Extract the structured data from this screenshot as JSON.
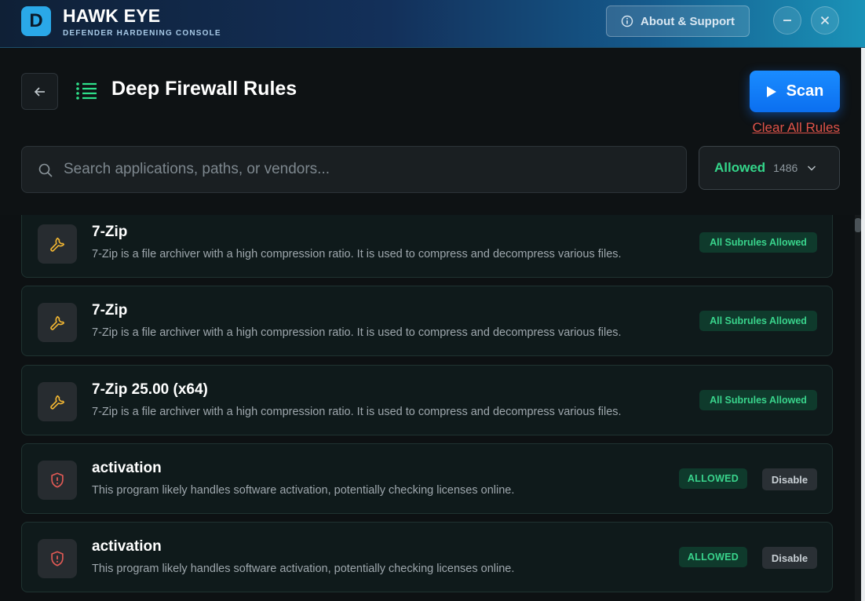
{
  "app": {
    "name": "HAWK EYE",
    "subtitle": "DEFENDER HARDENING CONSOLE",
    "logo_letter": "D"
  },
  "titlebar": {
    "about_label": "About & Support",
    "about_icon": "info-icon",
    "minimize_icon": "minus-icon",
    "close_icon": "close-icon"
  },
  "header": {
    "back_icon": "arrow-left-icon",
    "title_icon": "list-icon",
    "title": "Deep Firewall Rules",
    "scan_label": "Scan",
    "scan_icon": "play-icon",
    "clear_label": "Clear All Rules"
  },
  "search": {
    "placeholder": "Search applications, paths, or vendors...",
    "value": ""
  },
  "filter": {
    "selected": "Allowed",
    "count": "1486"
  },
  "colors": {
    "accent_blue": "#0b6ff0",
    "allowed_green": "#34d58a",
    "danger_red": "#e0534a",
    "wrench_yellow": "#f2b632"
  },
  "rules": [
    {
      "name": "7-Zip",
      "description": "7-Zip is a file archiver with a high compression ratio. It is used to compress and decompress various files.",
      "icon": "wrench-icon",
      "badge": "All Subrules Allowed"
    },
    {
      "name": "7-Zip",
      "description": "7-Zip is a file archiver with a high compression ratio. It is used to compress and decompress various files.",
      "icon": "wrench-icon",
      "badge": "All Subrules Allowed"
    },
    {
      "name": "7-Zip 25.00 (x64)",
      "description": "7-Zip is a file archiver with a high compression ratio. It is used to compress and decompress various files.",
      "icon": "wrench-icon",
      "badge": "All Subrules Allowed"
    },
    {
      "name": "activation",
      "description": "This program likely handles software activation, potentially checking licenses online.",
      "icon": "shield-alert-icon",
      "badge": "ALLOWED",
      "action": "Disable"
    },
    {
      "name": "activation",
      "description": "This program likely handles software activation, potentially checking licenses online.",
      "icon": "shield-alert-icon",
      "badge": "ALLOWED",
      "action": "Disable"
    }
  ]
}
